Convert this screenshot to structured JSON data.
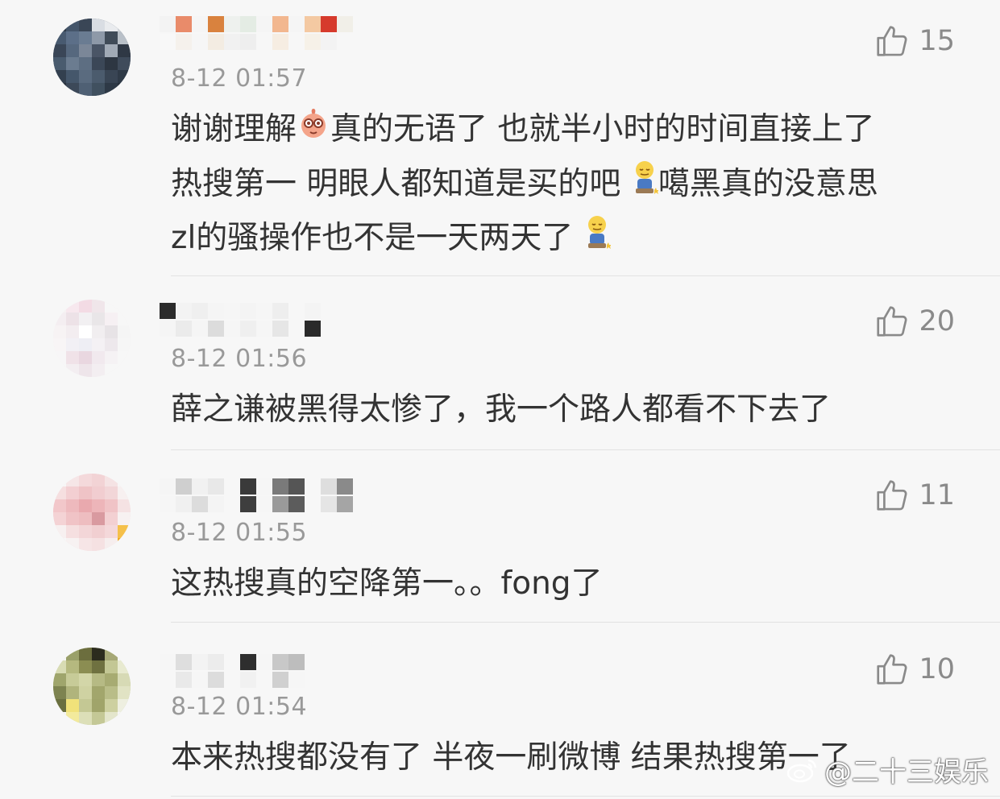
{
  "comments": [
    {
      "time": "8-12 01:57",
      "likes": "15",
      "lines": [
        "谢谢理解",
        "真的无语了 也就半小时的时间直接上了",
        "热搜第一 明眼人都知道是买的吧",
        "噶黑真的没意思",
        "zl的骚操作也不是一天两天了"
      ]
    },
    {
      "time": "8-12 01:56",
      "likes": "20",
      "text": "薛之谦被黑得太惨了，我一个路人都看不下去了"
    },
    {
      "time": "8-12 01:55",
      "likes": "11",
      "text": "这热搜真的空降第一。。fong了"
    },
    {
      "time": "8-12 01:54",
      "likes": "10",
      "text": "本来热搜都没有了 半夜一刷微博 结果热搜第一了"
    }
  ],
  "watermark": "@二十三娱乐",
  "icons": [
    "thumbs-up-icon",
    "weibo-logo-icon",
    "emoji-icon"
  ]
}
